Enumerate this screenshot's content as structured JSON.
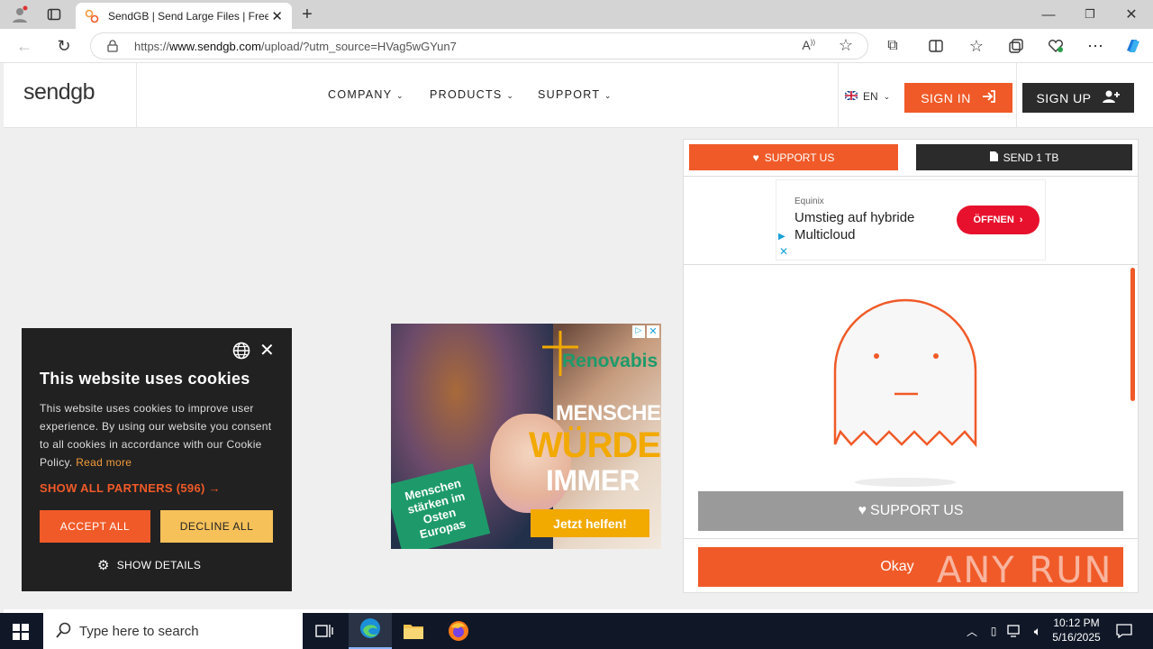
{
  "browser": {
    "tab_title": "SendGB | Send Large Files | Free f",
    "url_prefix": "https://",
    "url_host": "www.sendgb.com",
    "url_path": "/upload/?utm_source=HVag5wGYun7"
  },
  "header": {
    "logo_text": "sendgb",
    "nav": [
      "COMPANY",
      "PRODUCTS",
      "SUPPORT"
    ],
    "language": "EN",
    "sign_in": "SIGN IN",
    "sign_up": "SIGN UP",
    "colors": {
      "accent": "#f05a28",
      "dark": "#2b2b2b"
    }
  },
  "panel": {
    "support_us_top": "SUPPORT US",
    "send_1tb": "SEND 1 TB",
    "ad": {
      "advertiser": "Equinix",
      "headline": "Umstieg auf hybride Multicloud",
      "cta": "ÖFFNEN"
    },
    "support_us_button": "SUPPORT US",
    "okay_button": "Okay"
  },
  "ad_banner": {
    "brand": "Renovabis",
    "line1": "MENSCHEN",
    "line2": "WÜRDE",
    "line3": "IMMER",
    "tag": "Menschen stärken im Osten Europas",
    "cta": "Jetzt helfen!"
  },
  "cookie": {
    "title": "This website uses cookies",
    "body": "This website uses cookies to improve user experience. By using our website you consent to all cookies in accordance with our Cookie Policy.",
    "read_more": "Read more",
    "partners": "SHOW ALL PARTNERS (596) →",
    "accept": "ACCEPT ALL",
    "decline": "DECLINE ALL",
    "details": "SHOW DETAILS"
  },
  "watermark": "ANY RUN",
  "taskbar": {
    "search_placeholder": "Type here to search",
    "time": "10:12 PM",
    "date": "5/16/2025"
  }
}
